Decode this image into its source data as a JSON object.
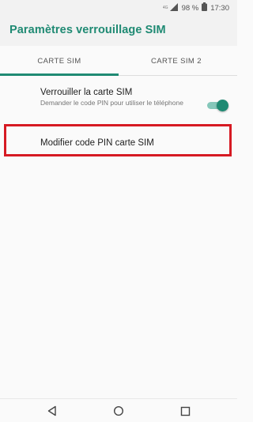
{
  "status_bar": {
    "network_tag": "4G",
    "battery": "98 %",
    "time": "17:30",
    "icons": [
      "signal-icon",
      "battery-icon"
    ]
  },
  "app_bar": {
    "title": "Paramètres verrouillage SIM"
  },
  "tabs": [
    {
      "label": "CARTE SIM",
      "selected": true
    },
    {
      "label": "CARTE SIM 2",
      "selected": false
    }
  ],
  "settings": {
    "lock_sim": {
      "title": "Verrouiller la carte SIM",
      "summary": "Demander le code PIN pour utiliser le téléphone",
      "enabled": true
    },
    "change_pin": {
      "title": "Modifier code PIN carte SIM"
    }
  },
  "nav_bar": {
    "icons": [
      "back-icon",
      "home-icon",
      "recents-icon"
    ]
  },
  "colors": {
    "accent": "#1f8a73",
    "highlight": "#d61a23",
    "toggle_track": "#85c7ba"
  }
}
